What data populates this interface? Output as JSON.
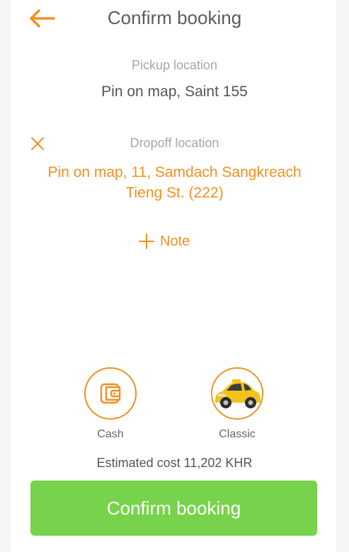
{
  "header": {
    "title": "Confirm booking",
    "back_icon": "arrow-left-icon"
  },
  "pickup": {
    "label": "Pickup location",
    "value": "Pin on map, Saint 155"
  },
  "dropoff": {
    "label": "Dropoff location",
    "value": "Pin on map, 11, Samdach Sangkreach Tieng St. (222)",
    "clear_icon": "close-icon"
  },
  "note": {
    "label": "Note",
    "icon": "plus-icon"
  },
  "options": {
    "payment": {
      "label": "Cash",
      "icon": "wallet-icon"
    },
    "vehicle": {
      "label": "Classic",
      "icon": "taxi-car-icon"
    }
  },
  "estimate": {
    "text": "Estimated cost 11,202 KHR"
  },
  "confirm": {
    "label": "Confirm booking"
  },
  "colors": {
    "accent": "#f2901e",
    "confirm_button": "#77d34b",
    "title_text": "#5c5c5c",
    "label_text": "#a6a6a6"
  }
}
